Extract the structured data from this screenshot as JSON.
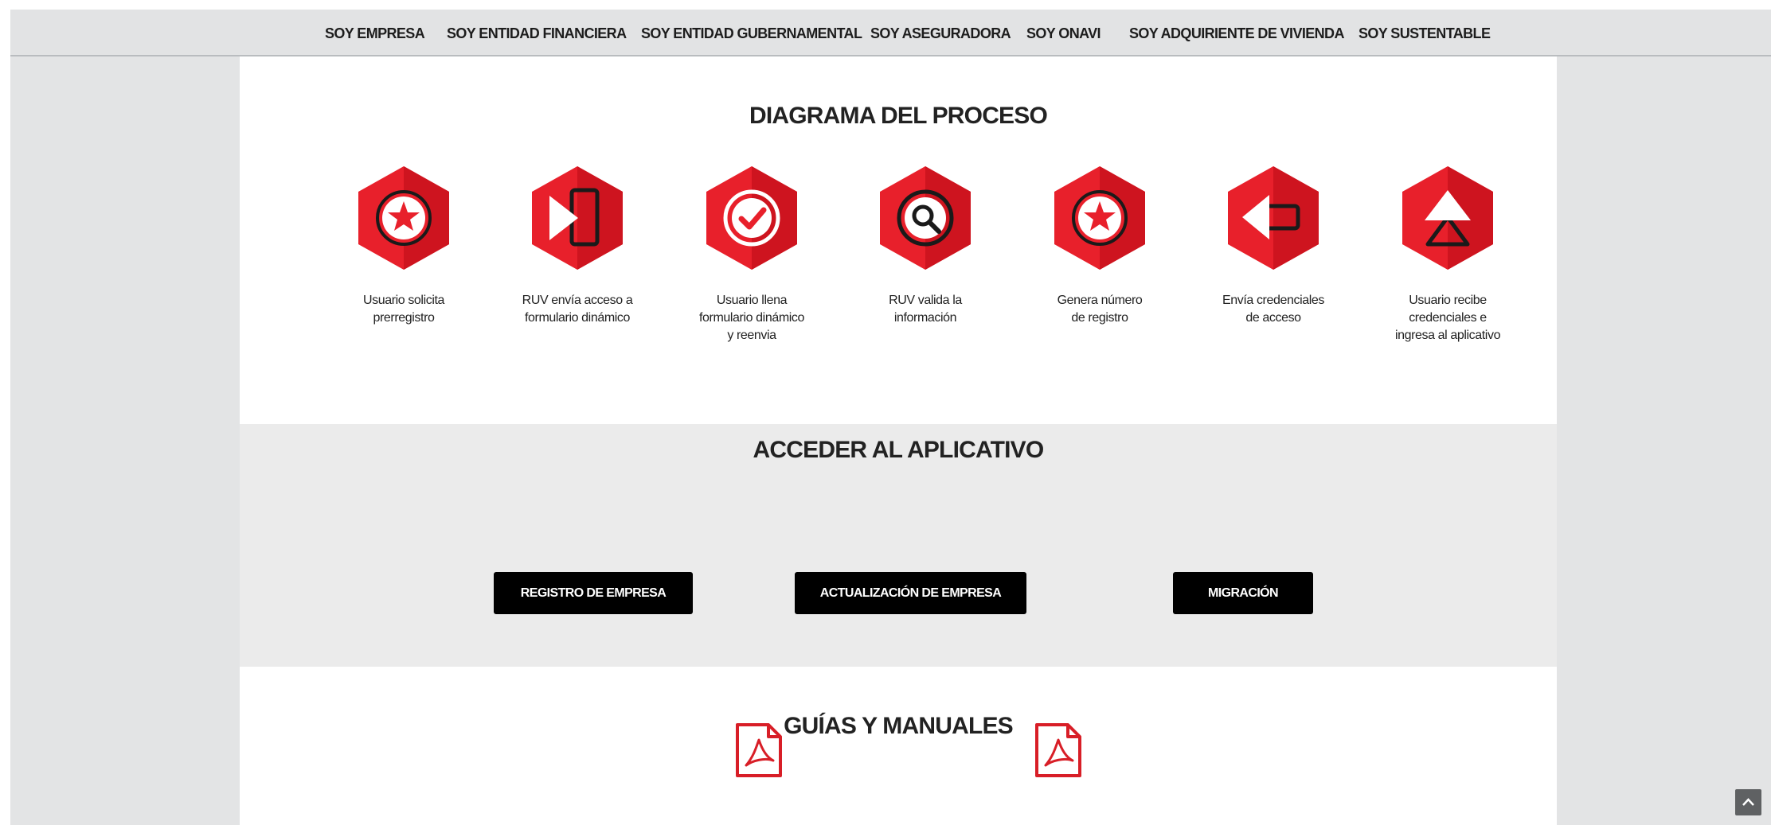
{
  "nav": {
    "items": [
      {
        "label": "SOY EMPRESA"
      },
      {
        "label": "SOY ENTIDAD FINANCIERA"
      },
      {
        "label": "SOY ENTIDAD GUBERNAMENTAL"
      },
      {
        "label": "SOY ASEGURADORA"
      },
      {
        "label": "SOY ONAVI"
      },
      {
        "label": "SOY ADQUIRIENTE DE VIVIENDA"
      },
      {
        "label": "SOY SUSTENTABLE"
      }
    ]
  },
  "diagram": {
    "title": "DIAGRAMA DEL PROCESO",
    "steps": [
      {
        "icon": "star-icon",
        "line1": "Usuario solicita",
        "line2": "prerregistro",
        "line3": ""
      },
      {
        "icon": "enter-door-icon",
        "line1": "RUV envía acceso a",
        "line2": "formulario dinámico",
        "line3": ""
      },
      {
        "icon": "check-icon",
        "line1": "Usuario llena",
        "line2": "formulario dinámico",
        "line3": "y reenvia"
      },
      {
        "icon": "magnifier-icon",
        "line1": "RUV valida la",
        "line2": "información",
        "line3": ""
      },
      {
        "icon": "star-icon",
        "line1": "Genera número",
        "line2": "de registro",
        "line3": ""
      },
      {
        "icon": "send-arrow-icon",
        "line1": "Envía credenciales",
        "line2": "de acceso",
        "line3": ""
      },
      {
        "icon": "eject-icon",
        "line1": "Usuario recibe",
        "line2": "credenciales e",
        "line3": "ingresa al aplicativo"
      }
    ]
  },
  "access": {
    "title": "ACCEDER AL APLICATIVO",
    "buttons": [
      {
        "label": "REGISTRO DE EMPRESA"
      },
      {
        "label": "ACTUALIZACIÓN DE EMPRESA"
      },
      {
        "label": "MIGRACIÓN"
      }
    ]
  },
  "guides": {
    "title": "GUÍAS Y MANUALES",
    "icons": [
      "pdf-icon",
      "pdf-icon"
    ]
  },
  "colors": {
    "accent_red": "#e8202b",
    "button_bg": "#000000",
    "page_bg": "#e3e4e5",
    "access_bg": "#ebebeb"
  }
}
